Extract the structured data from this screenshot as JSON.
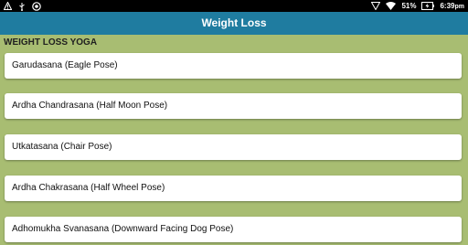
{
  "status": {
    "battery_percent": "51%",
    "time": "6:39",
    "ampm": "pm"
  },
  "app": {
    "title": "Weight Loss"
  },
  "section": {
    "header": "WEIGHT LOSS YOGA"
  },
  "poses": [
    "Garudasana (Eagle Pose)",
    "Ardha Chandrasana (Half Moon Pose)",
    "Utkatasana (Chair Pose)",
    "Ardha Chakrasana (Half Wheel Pose)",
    "Adhomukha Svanasana (Downward Facing Dog Pose)"
  ]
}
